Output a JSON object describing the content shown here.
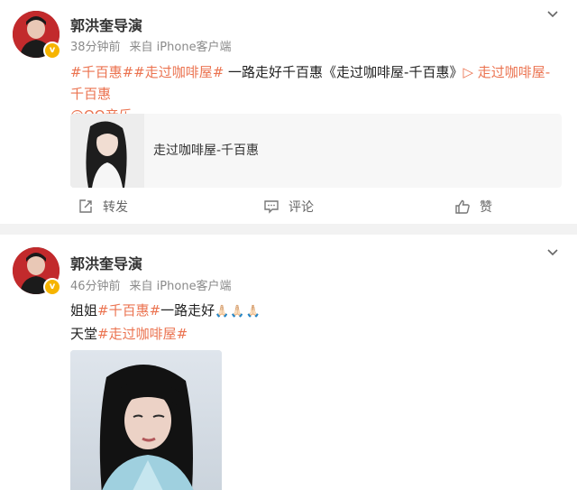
{
  "posts": [
    {
      "author": "郭洪奎导演",
      "time": "38分钟前",
      "source": "来自 iPhone客户端",
      "content": {
        "tag1": "#千百惠#",
        "tag2": "#走过咖啡屋#",
        "text1": " 一路走好千百惠《走过咖啡屋-千百惠》",
        "music_link": "▷ 走过咖啡屋-千百惠",
        "qq_link": "@QQ音乐"
      },
      "music_card": {
        "title": "走过咖啡屋-千百惠"
      },
      "actions": {
        "repost": "转发",
        "comment": "评论",
        "like": "赞"
      }
    },
    {
      "author": "郭洪奎导演",
      "time": "46分钟前",
      "source": "来自 iPhone客户端",
      "content": {
        "text1": "姐姐",
        "tag1": "#千百惠#",
        "text2": "一路走好",
        "emoji": "🙏🏻🙏🏻🙏🏻",
        "text3": "天堂",
        "tag2": "#走过咖啡屋#"
      }
    }
  ],
  "icons": {
    "more": "chevron-down-icon",
    "verified": "verified-badge-icon",
    "repost": "repost-icon",
    "comment": "comment-icon",
    "like": "thumbs-up-icon"
  },
  "colors": {
    "link": "#eb7350",
    "meta_text": "#8a8a8a",
    "verified": "#f6b400",
    "separator": "#f2f2f2"
  }
}
